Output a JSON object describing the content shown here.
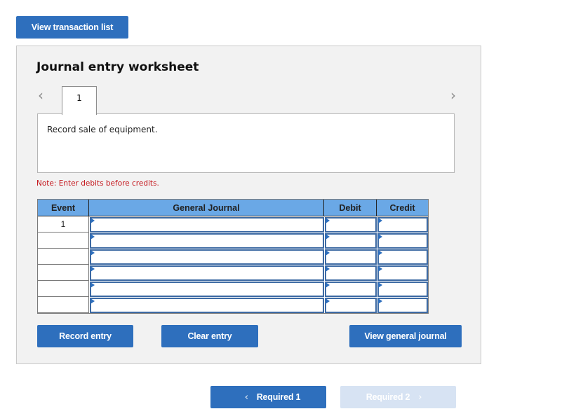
{
  "top": {
    "view_transaction_label": "View transaction list"
  },
  "worksheet": {
    "title": "Journal entry worksheet",
    "tabs": [
      {
        "label": "1",
        "active": true
      }
    ],
    "prev_icon": "chevron-left-icon",
    "next_icon": "chevron-right-icon",
    "description": "Record sale of equipment.",
    "note": "Note: Enter debits before credits."
  },
  "table": {
    "headers": {
      "event": "Event",
      "general_journal": "General Journal",
      "debit": "Debit",
      "credit": "Credit"
    },
    "rows": [
      {
        "event": "1",
        "account": "",
        "debit": "",
        "credit": ""
      },
      {
        "event": "",
        "account": "",
        "debit": "",
        "credit": ""
      },
      {
        "event": "",
        "account": "",
        "debit": "",
        "credit": ""
      },
      {
        "event": "",
        "account": "",
        "debit": "",
        "credit": ""
      },
      {
        "event": "",
        "account": "",
        "debit": "",
        "credit": ""
      },
      {
        "event": "",
        "account": "",
        "debit": "",
        "credit": ""
      }
    ]
  },
  "actions": {
    "record_entry": "Record entry",
    "clear_entry": "Clear entry",
    "view_general_journal": "View general journal"
  },
  "navigation": {
    "prev_label": "Required 1",
    "next_label": "Required 2",
    "prev_chevron": "‹",
    "next_chevron": "›",
    "next_disabled": true
  },
  "colors": {
    "primary": "#2e6fbd",
    "header_blue": "#6aa8e6",
    "note_red": "#c4161c",
    "disabled": "#d7e3f3"
  }
}
